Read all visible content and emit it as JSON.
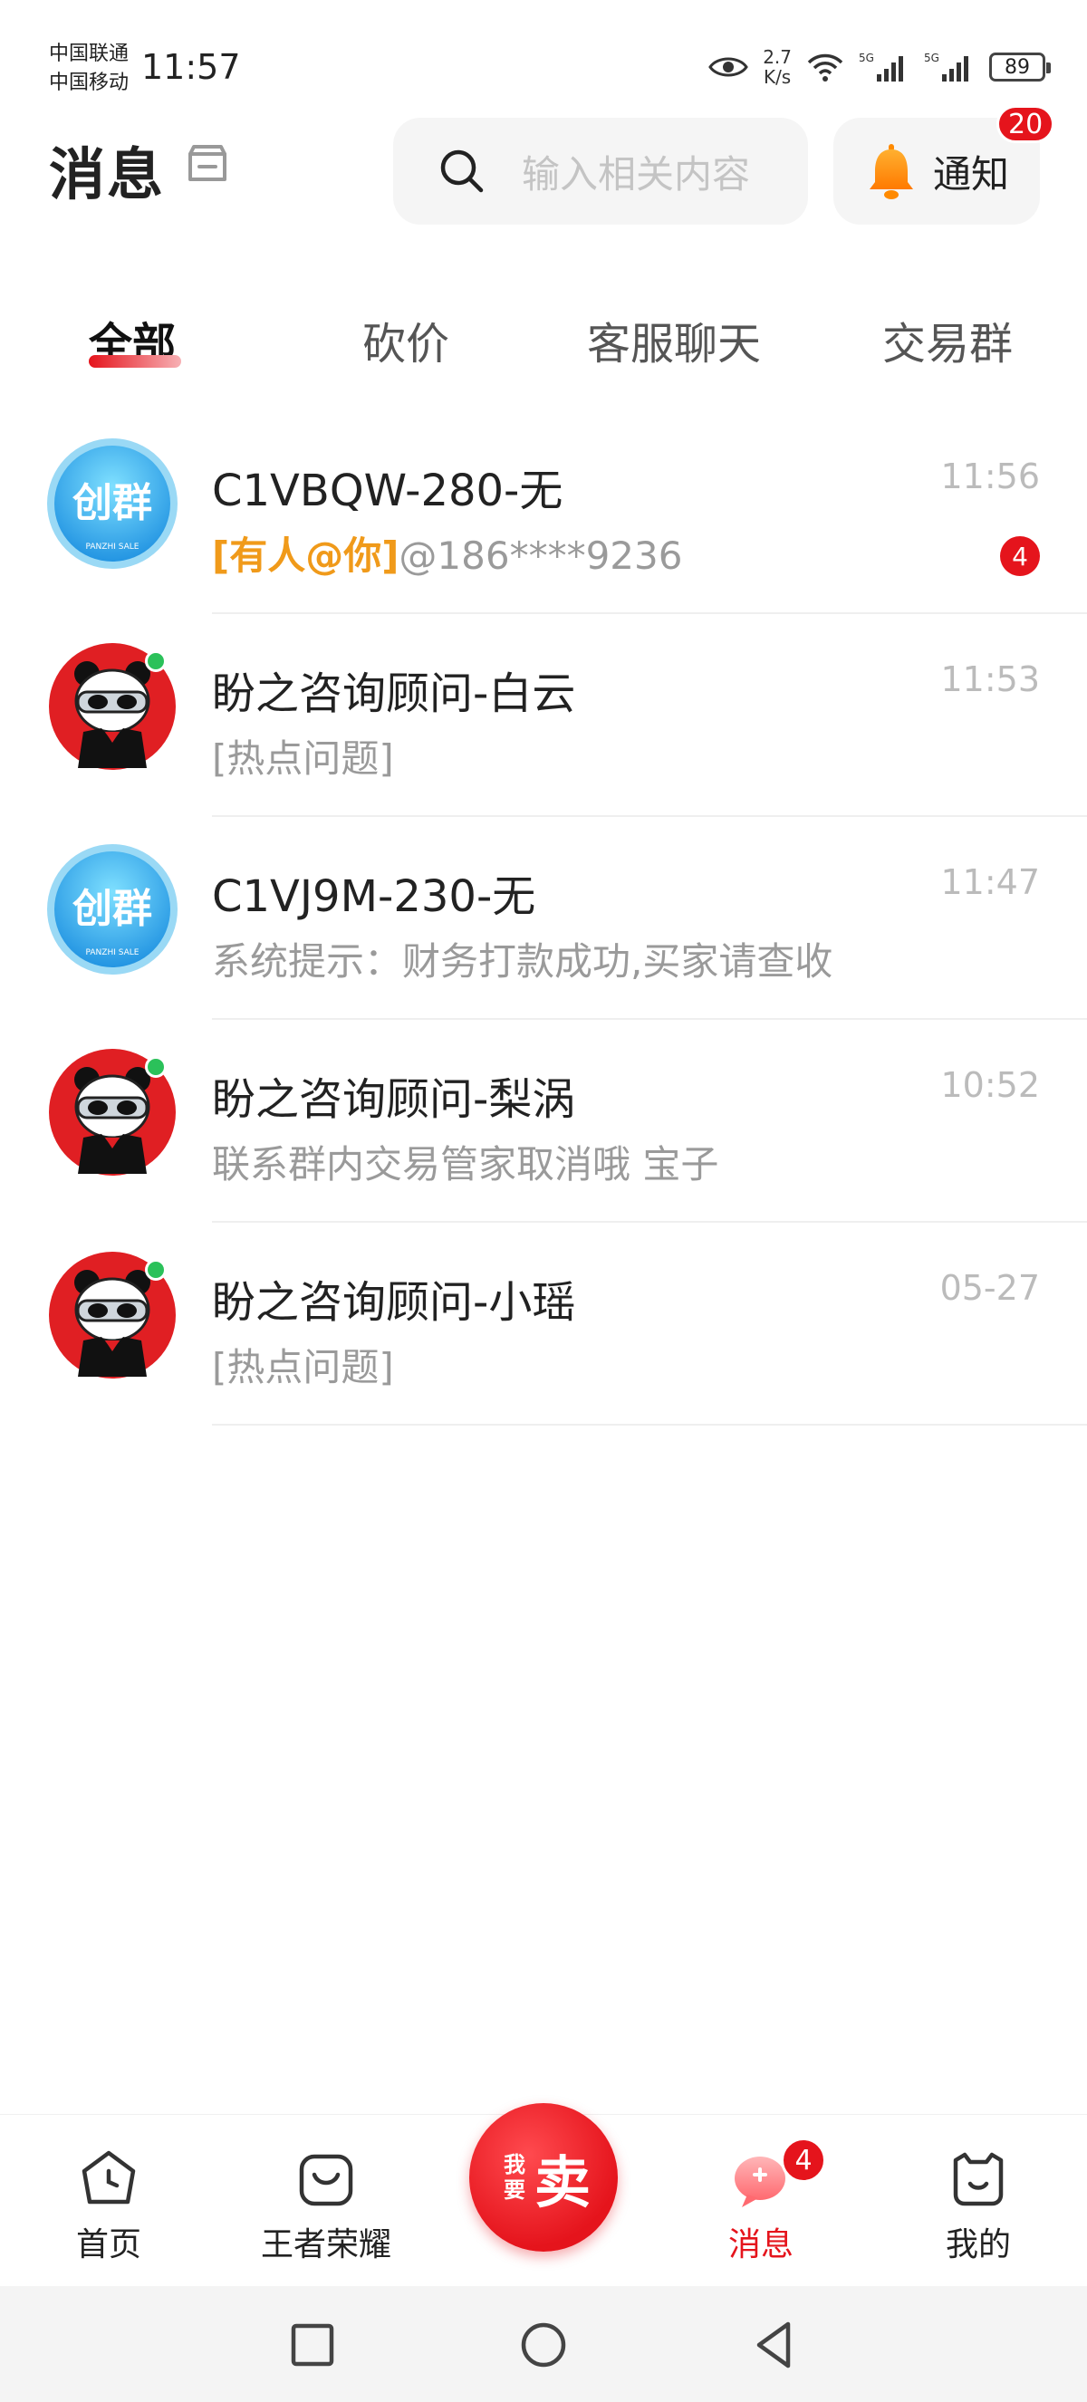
{
  "status_bar": {
    "carrier_1": "中国联通",
    "carrier_2": "中国移动",
    "time": "11:57",
    "net_speed_value": "2.7",
    "net_speed_unit": "K/s",
    "network_1": "5G",
    "network_2": "5G",
    "battery": "89"
  },
  "header": {
    "title": "消息",
    "search_placeholder": "输入相关内容",
    "notify_label": "通知",
    "notify_count": "20"
  },
  "tabs": [
    {
      "label": "全部",
      "active": true
    },
    {
      "label": "砍价",
      "active": false
    },
    {
      "label": "客服聊天",
      "active": false
    },
    {
      "label": "交易群",
      "active": false
    }
  ],
  "conversations": [
    {
      "name": "C1VBQW-280-无",
      "time": "11:56",
      "mention": "[有人@你]",
      "preview": "@186****9236",
      "unread": "4",
      "avatar": "group-logo",
      "online": false
    },
    {
      "name": "盼之咨询顾问-白云",
      "time": "11:53",
      "mention": "",
      "preview": "[热点问题]",
      "unread": "",
      "avatar": "panda-mascot",
      "online": true
    },
    {
      "name": "C1VJ9M-230-无",
      "time": "11:47",
      "mention": "",
      "preview": "系统提示：财务打款成功,买家请查收",
      "unread": "",
      "avatar": "group-logo",
      "online": false
    },
    {
      "name": "盼之咨询顾问-梨涡",
      "time": "10:52",
      "mention": "",
      "preview": "联系群内交易管家取消哦 宝子",
      "unread": "",
      "avatar": "panda-mascot",
      "online": true
    },
    {
      "name": "盼之咨询顾问-小瑶",
      "time": "05-27",
      "mention": "",
      "preview": "[热点问题]",
      "unread": "",
      "avatar": "panda-mascot",
      "online": true
    }
  ],
  "group_logo": {
    "text": "创群",
    "subtext": "PANZHI SALE"
  },
  "bottom_nav": {
    "items": [
      {
        "label": "首页",
        "icon": "home-icon",
        "active": false
      },
      {
        "label": "王者荣耀",
        "icon": "game-bag-icon",
        "active": false
      },
      {
        "label": "消息",
        "icon": "message-icon",
        "active": true
      },
      {
        "label": "我的",
        "icon": "profile-icon",
        "active": false
      }
    ],
    "sell_small": "我要",
    "sell_big": "卖",
    "message_badge": "4"
  },
  "colors": {
    "accent": "#e5141c",
    "mention": "#f09a1a",
    "online": "#2bc15a",
    "muted_text": "#9a9a9a"
  }
}
